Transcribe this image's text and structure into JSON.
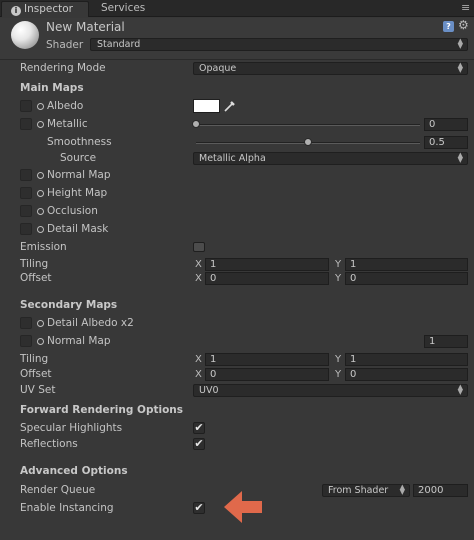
{
  "tabs": [
    {
      "label": "Inspector"
    },
    {
      "label": "Services"
    }
  ],
  "material": {
    "name": "New Material",
    "shader_label": "Shader",
    "shader_value": "Standard"
  },
  "rendering_mode": {
    "label": "Rendering Mode",
    "value": "Opaque"
  },
  "main_maps": {
    "title": "Main Maps",
    "albedo": {
      "label": "Albedo",
      "color": "#ffffff"
    },
    "metallic": {
      "label": "Metallic",
      "value": "0",
      "fraction": 0.0
    },
    "smoothness": {
      "label": "Smoothness",
      "value": "0.5",
      "fraction": 0.5
    },
    "source": {
      "label": "Source",
      "value": "Metallic Alpha"
    },
    "normal_map": "Normal Map",
    "height_map": "Height Map",
    "occlusion": "Occlusion",
    "detail_mask": "Detail Mask",
    "emission": "Emission",
    "tiling": {
      "label": "Tiling",
      "x": "1",
      "y": "1"
    },
    "offset": {
      "label": "Offset",
      "x": "0",
      "y": "0"
    }
  },
  "secondary_maps": {
    "title": "Secondary Maps",
    "detail_albedo": "Detail Albedo x2",
    "normal_map": {
      "label": "Normal Map",
      "value": "1"
    },
    "tiling": {
      "label": "Tiling",
      "x": "1",
      "y": "1"
    },
    "offset": {
      "label": "Offset",
      "x": "0",
      "y": "0"
    },
    "uv_set": {
      "label": "UV Set",
      "value": "UV0"
    }
  },
  "forward_rendering": {
    "title": "Forward Rendering Options",
    "specular_highlights": {
      "label": "Specular Highlights",
      "checked": true
    },
    "reflections": {
      "label": "Reflections",
      "checked": true
    }
  },
  "advanced": {
    "title": "Advanced Options",
    "render_queue": {
      "label": "Render Queue",
      "mode": "From Shader",
      "value": "2000"
    },
    "enable_instancing": {
      "label": "Enable Instancing",
      "checked": true
    }
  },
  "axis_labels": {
    "x": "X",
    "y": "Y"
  },
  "colors": {
    "panel_bg": "#383838",
    "arrow": "#e0694b",
    "field_bg": "#2b2b2b"
  },
  "icons": [
    "info-icon",
    "menu-icon",
    "material-sphere-icon",
    "help-book-icon",
    "gear-icon",
    "eyedropper-icon",
    "check-icon",
    "orange-arrow-icon"
  ]
}
